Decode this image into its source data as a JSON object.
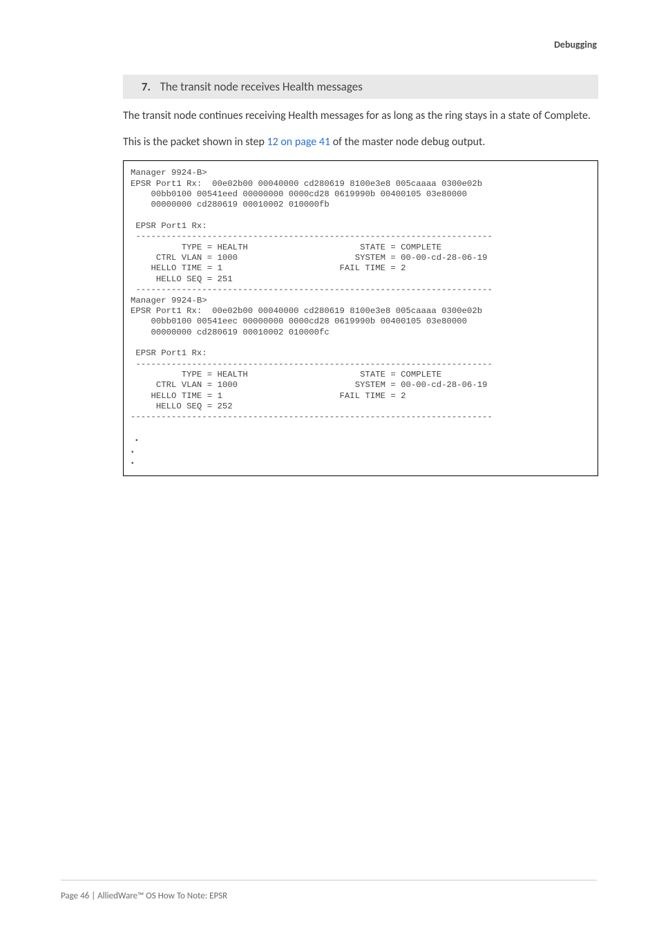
{
  "header": {
    "right": "Debugging"
  },
  "step": {
    "num": "7.",
    "title": "The transit node receives Health messages"
  },
  "para1": "The transit node continues receiving Health messages for as long as the ring stays in a state of Complete.",
  "para2_a": "This is the packet shown in step ",
  "para2_link": "12 on page 41",
  "para2_b": " of the master node debug output.",
  "code": "Manager 9924-B>\nEPSR Port1 Rx:  00e02b00 00040000 cd280619 8100e3e8 005caaaa 0300e02b\n    00bb0100 00541eed 00000000 0000cd28 0619990b 00400105 03e80000\n    00000000 cd280619 00010002 010000fb\n\n EPSR Port1 Rx:\n ----------------------------------------------------------------------\n          TYPE = HEALTH                      STATE = COMPLETE\n     CTRL VLAN = 1000                       SYSTEM = 00-00-cd-28-06-19\n    HELLO TIME = 1                       FAIL TIME = 2\n     HELLO SEQ = 251\n ----------------------------------------------------------------------\nManager 9924-B>\nEPSR Port1 Rx:  00e02b00 00040000 cd280619 8100e3e8 005caaaa 0300e02b\n    00bb0100 00541eec 00000000 0000cd28 0619990b 00400105 03e80000\n    00000000 cd280619 00010002 010000fc\n\n EPSR Port1 Rx:\n ----------------------------------------------------------------------\n          TYPE = HEALTH                      STATE = COMPLETE\n     CTRL VLAN = 1000                       SYSTEM = 00-00-cd-28-06-19\n    HELLO TIME = 1                       FAIL TIME = 2\n     HELLO SEQ = 252\n-----------------------------------------------------------------------",
  "footer": {
    "left": "Page 46 | AlliedWare™ OS How To Note: EPSR"
  }
}
